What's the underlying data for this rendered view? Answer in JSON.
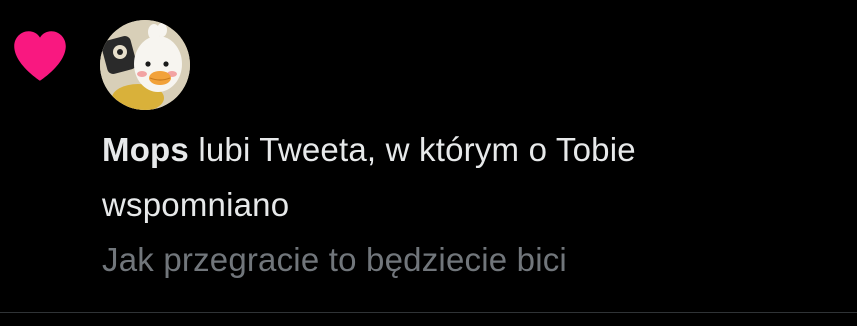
{
  "notification": {
    "icon": "heart-icon",
    "icon_color": "#f91880",
    "avatar": "duck-avatar-icon",
    "actor_name": "Mops",
    "action_text": "lubi Tweeta, w którym o Tobie wspomniano",
    "tweet_preview": "Jak przegracie to będziecie bici"
  },
  "colors": {
    "background": "#000000",
    "primary_text": "#e7e9ea",
    "secondary_text": "#71767b",
    "divider": "#2f3336"
  }
}
